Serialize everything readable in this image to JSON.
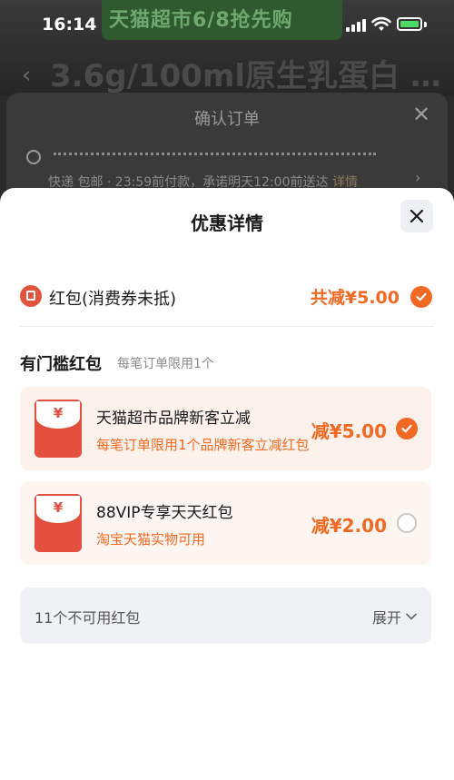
{
  "status_bar": {
    "time": "16:14"
  },
  "background": {
    "banner_text": "天猫超市6/8抢先购",
    "product_title": "3.6g/100ml原生乳蛋白 …",
    "confirm_title": "确认订单",
    "shipping_text": "快递 包邮 · 23:59前付款，承诺明天12:00前送达",
    "shipping_link": "详情"
  },
  "modal": {
    "title": "优惠详情",
    "summary": {
      "label": "红包(消费券未抵)",
      "amount": "共减¥5.00",
      "checked": true
    },
    "section": {
      "title": "有门槛红包",
      "subtitle": "每笔订单限用1个"
    },
    "coupons": [
      {
        "symbol": "¥",
        "name": "天猫超市品牌新客立减",
        "desc": "每笔订单限用1个品牌新客立减红包",
        "amount": "减¥5.00",
        "selected": true
      },
      {
        "symbol": "¥",
        "name": "88VIP专享天天红包",
        "desc": "淘宝天猫实物可用",
        "amount": "减¥2.00",
        "selected": false
      }
    ],
    "unavailable": {
      "label": "11个不可用红包",
      "expand_label": "展开"
    }
  },
  "colors": {
    "accent": "#f06a23",
    "red": "#e24f3e",
    "sheet": "#ffffff"
  },
  "icons": [
    "close-icon",
    "check-icon",
    "chevron-down-icon",
    "red-packet-icon",
    "location-pin-icon",
    "back-arrow-icon"
  ]
}
